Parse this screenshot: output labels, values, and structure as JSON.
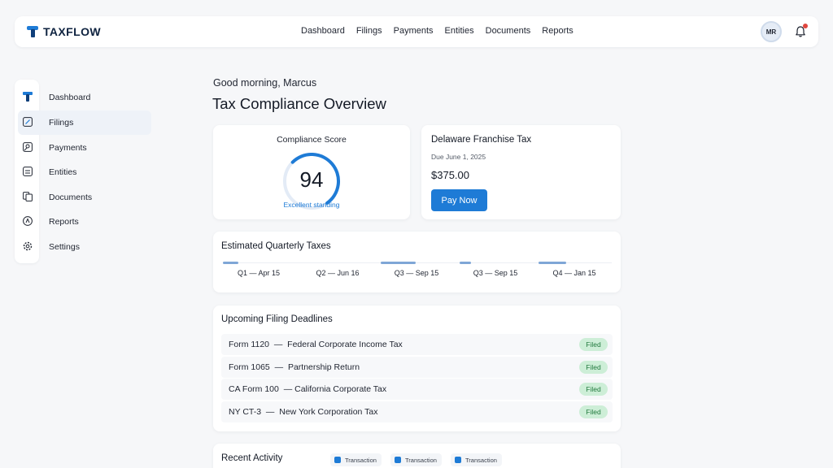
{
  "brand": {
    "name": "TAXFLOW",
    "accent": "#1e7bd6"
  },
  "topnav": {
    "items": [
      "Dashboard",
      "Filings",
      "Payments",
      "Entities",
      "Documents",
      "Reports"
    ],
    "avatar_initials": "MR",
    "notification_icon": "bell-icon"
  },
  "sidebar": {
    "items": [
      {
        "label": "Dashboard",
        "icon": "logo-icon",
        "active": false
      },
      {
        "label": "Filings",
        "icon": "edit-icon",
        "active": true
      },
      {
        "label": "Payments",
        "icon": "payment-icon",
        "active": false
      },
      {
        "label": "Entities",
        "icon": "building-icon",
        "active": false
      },
      {
        "label": "Documents",
        "icon": "documents-icon",
        "active": false
      },
      {
        "label": "Reports",
        "icon": "reports-icon",
        "active": false
      },
      {
        "label": "Settings",
        "icon": "gear-icon",
        "active": false
      }
    ]
  },
  "main": {
    "greeting": "Good morning, Marcus",
    "title": "Tax Compliance Overview"
  },
  "compliance": {
    "label": "Compliance Score",
    "score": "94",
    "score_fraction": 0.94,
    "status": "Excellent standing"
  },
  "franchise_tax": {
    "title": "Delaware Franchise Tax",
    "due": "Due June 1, 2025",
    "amount": "$375.00",
    "button": "Pay Now"
  },
  "quarterly": {
    "title": "Estimated Quarterly Taxes",
    "items": [
      {
        "label": "Q1 — Apr 15",
        "progress": 0.2
      },
      {
        "label": "Q2 — Jun 16",
        "progress": 0
      },
      {
        "label": "Q3 — Sep 15",
        "progress": 0.45
      },
      {
        "label": "Q3 — Sep 15",
        "progress": 0.15
      },
      {
        "label": "Q4 — Jan 15",
        "progress": 0.35
      }
    ]
  },
  "deadlines": {
    "title": "Upcoming Filing Deadlines",
    "rows": [
      {
        "text": "Form 1120  —  Federal Corporate Income Tax",
        "status": "Filed"
      },
      {
        "text": "Form 1065  —  Partnership Return",
        "status": "Filed"
      },
      {
        "text": "CA Form 100  — California Corporate Tax",
        "status": "Filed"
      },
      {
        "text": "NY CT-3  —  New York Corporation Tax",
        "status": "Filed"
      }
    ]
  },
  "activity": {
    "title": "Recent Activity",
    "chips": [
      "Transaction",
      "Transaction",
      "Transaction"
    ]
  }
}
